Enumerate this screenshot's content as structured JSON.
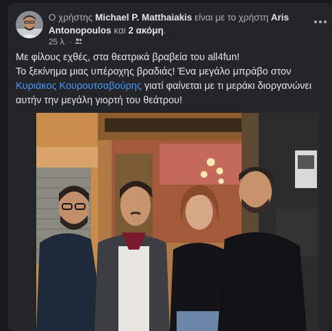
{
  "post": {
    "author_prefix": "Ο χρήστης ",
    "author_name": "Michael P. Matthaiakis",
    "with_text": " είναι με το χρήστη ",
    "tagged_first": "Aris Antonopoulos",
    "and_text": " και ",
    "tagged_more": "2 ακόμη",
    "period": ".",
    "timestamp": "25 λ.",
    "separator": "·",
    "audience_icon": "friends-icon",
    "more_icon": "more-options-icon",
    "line1": "Με φίλους εχθές, στα θεατρικά βραβεία του all4fun!",
    "line2_start": "Το ξεκίνημα μιας υπέροχης βραδιάς! Ένα μεγάλο μπράβο στον ",
    "mention": "Κυριάκος Κουρουτσαβούρης",
    "line2_end": " γιατί φαίνεται με τι μεράκι διοργανώνει αυτήν την μεγάλη γιορτή του θεάτρου!"
  },
  "colors": {
    "background": "#18191a",
    "card": "#242526",
    "text_primary": "#e4e6eb",
    "text_secondary": "#b0b3b8",
    "mention": "#4599ff"
  }
}
